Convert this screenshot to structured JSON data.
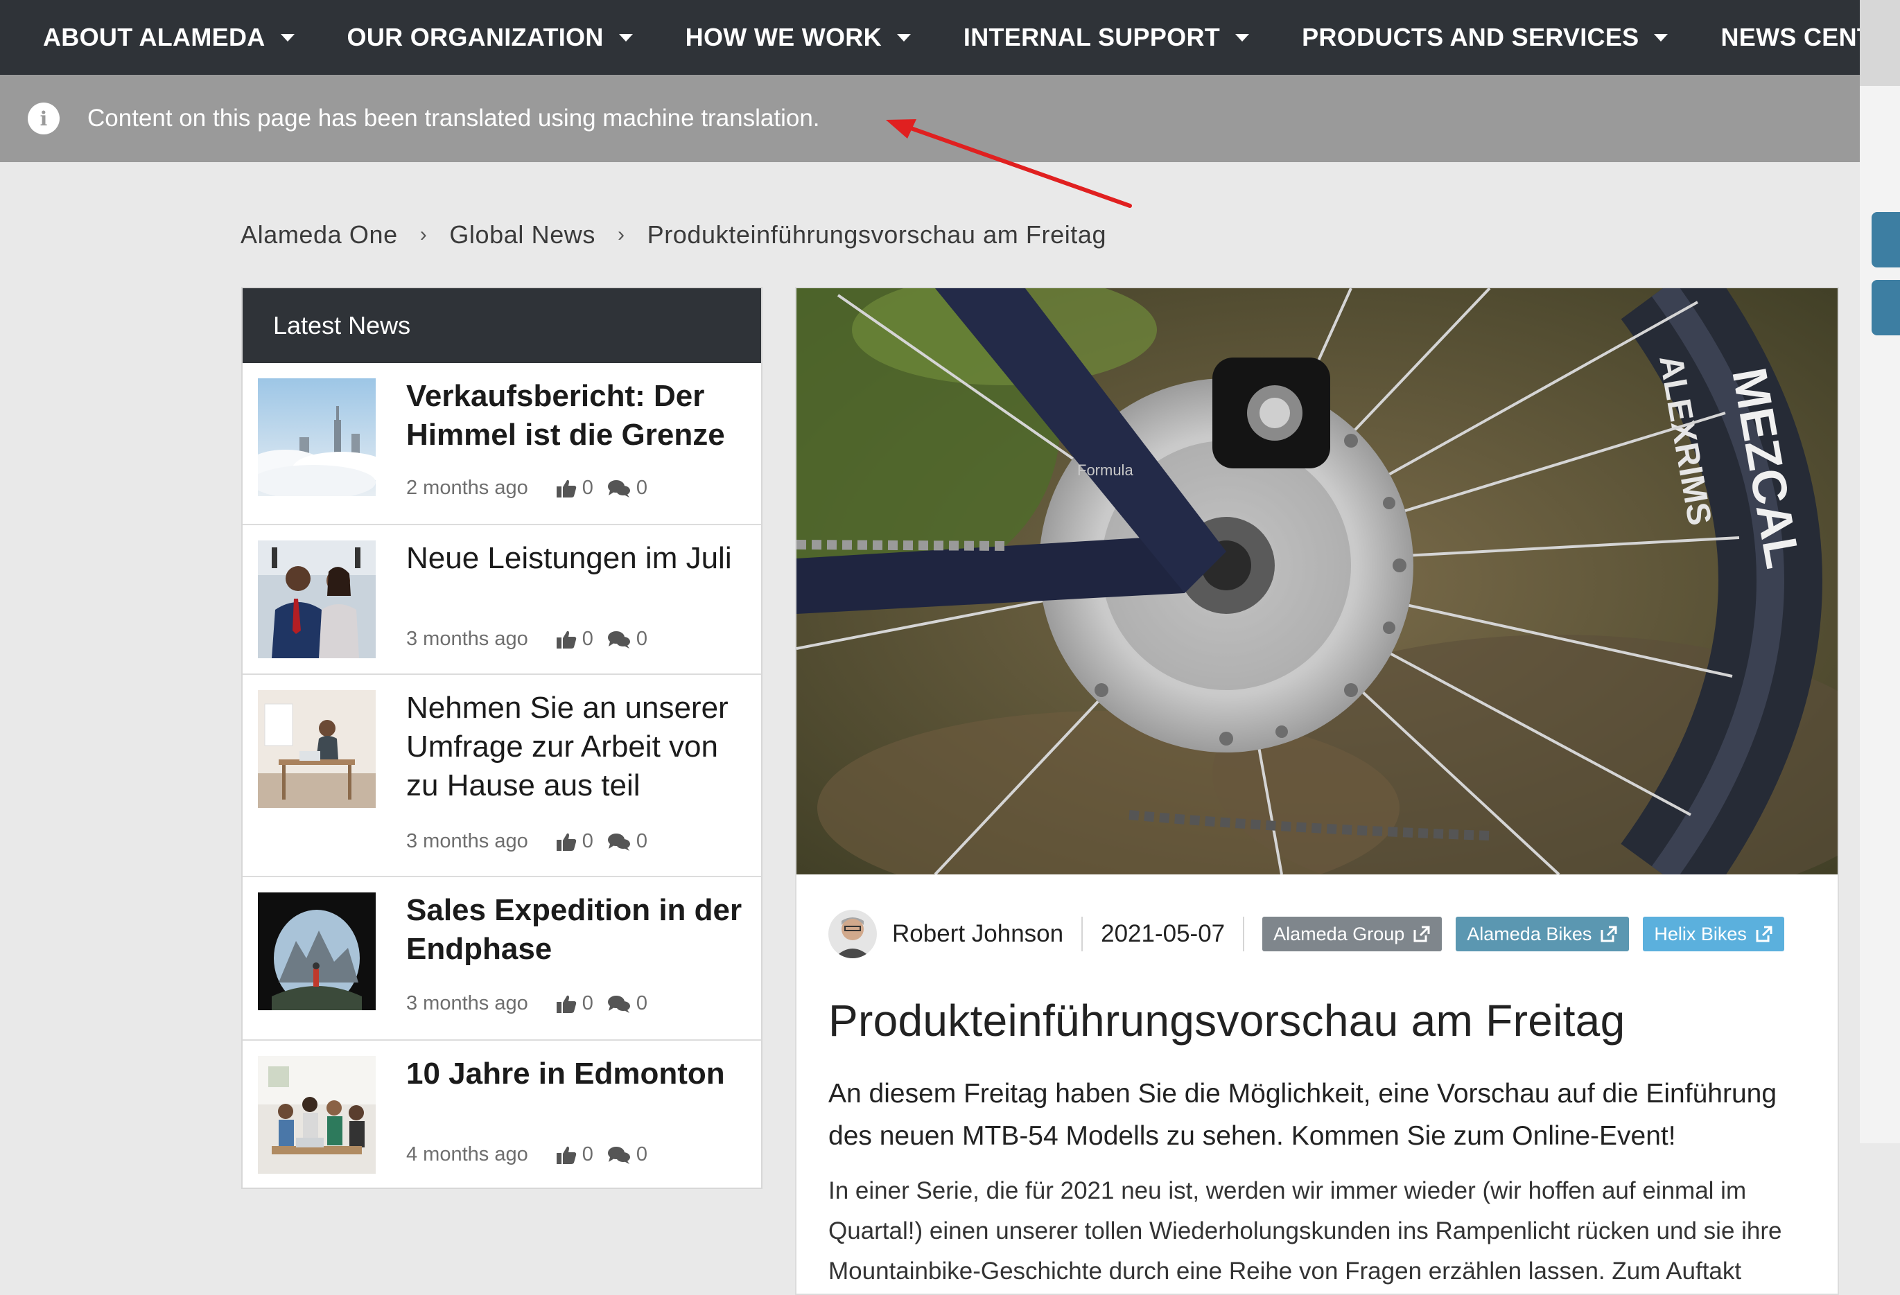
{
  "nav": {
    "items": [
      {
        "label": "ABOUT ALAMEDA",
        "dropdown": true
      },
      {
        "label": "OUR ORGANIZATION",
        "dropdown": true
      },
      {
        "label": "HOW WE WORK",
        "dropdown": true
      },
      {
        "label": "INTERNAL SUPPORT",
        "dropdown": true
      },
      {
        "label": "PRODUCTS AND SERVICES",
        "dropdown": true
      },
      {
        "label": "NEWS CENTER",
        "dropdown": false
      }
    ]
  },
  "notice": {
    "icon": "info-icon",
    "text": "Content on this page has been translated using machine translation."
  },
  "breadcrumb": {
    "items": [
      "Alameda One",
      "Global News",
      "Produkteinführungsvorschau am Freitag"
    ],
    "separator": "›"
  },
  "latest_news": {
    "header": "Latest News",
    "items": [
      {
        "title": "Verkaufsbericht: Der Himmel ist die Grenze",
        "bold": true,
        "ago": "2 months ago",
        "likes": "0",
        "comments": "0",
        "image": "clouds-skyline"
      },
      {
        "title": "Neue Leistungen im Juli",
        "bold": false,
        "ago": "3 months ago",
        "likes": "0",
        "comments": "0",
        "image": "business-people"
      },
      {
        "title": "Nehmen Sie an unserer Umfrage zur Arbeit von zu Hause aus teil",
        "bold": false,
        "ago": "3 months ago",
        "likes": "0",
        "comments": "0",
        "image": "home-office"
      },
      {
        "title": "Sales Expedition in der Endphase",
        "bold": true,
        "ago": "3 months ago",
        "likes": "0",
        "comments": "0",
        "image": "cave-mountains"
      },
      {
        "title": "10 Jahre in Edmonton",
        "bold": true,
        "ago": "4 months ago",
        "likes": "0",
        "comments": "0",
        "image": "team-group"
      }
    ]
  },
  "article": {
    "hero_image": "mountain-bike-disc-brake",
    "author": "Robert Johnson",
    "date": "2021-05-07",
    "tags": [
      {
        "label": "Alameda Group",
        "color": "#7f868c"
      },
      {
        "label": "Alameda Bikes",
        "color": "#5b97b1"
      },
      {
        "label": "Helix Bikes",
        "color": "#5bb0dd"
      }
    ],
    "title": "Produkteinführungsvorschau am Freitag",
    "lead": "An diesem Freitag haben Sie die Möglichkeit, eine Vorschau auf die Einführung des neuen MTB-54 Modells zu sehen. Kommen Sie zum Online-Event!",
    "body": "In einer Serie, die für 2021 neu ist, werden wir immer wieder (wir hoffen auf einmal im Quartal!) einen unserer tollen Wiederholungskunden ins Rampenlicht rücken und sie ihre Mountainbike-Geschichte durch eine Reihe von Fragen erzählen lassen. Zum Auftakt"
  },
  "colors": {
    "nav_bg": "#2f3338",
    "notice_bg": "#9a9a9a",
    "page_bg": "#e9e9e9",
    "annotation_arrow": "#e02020"
  }
}
